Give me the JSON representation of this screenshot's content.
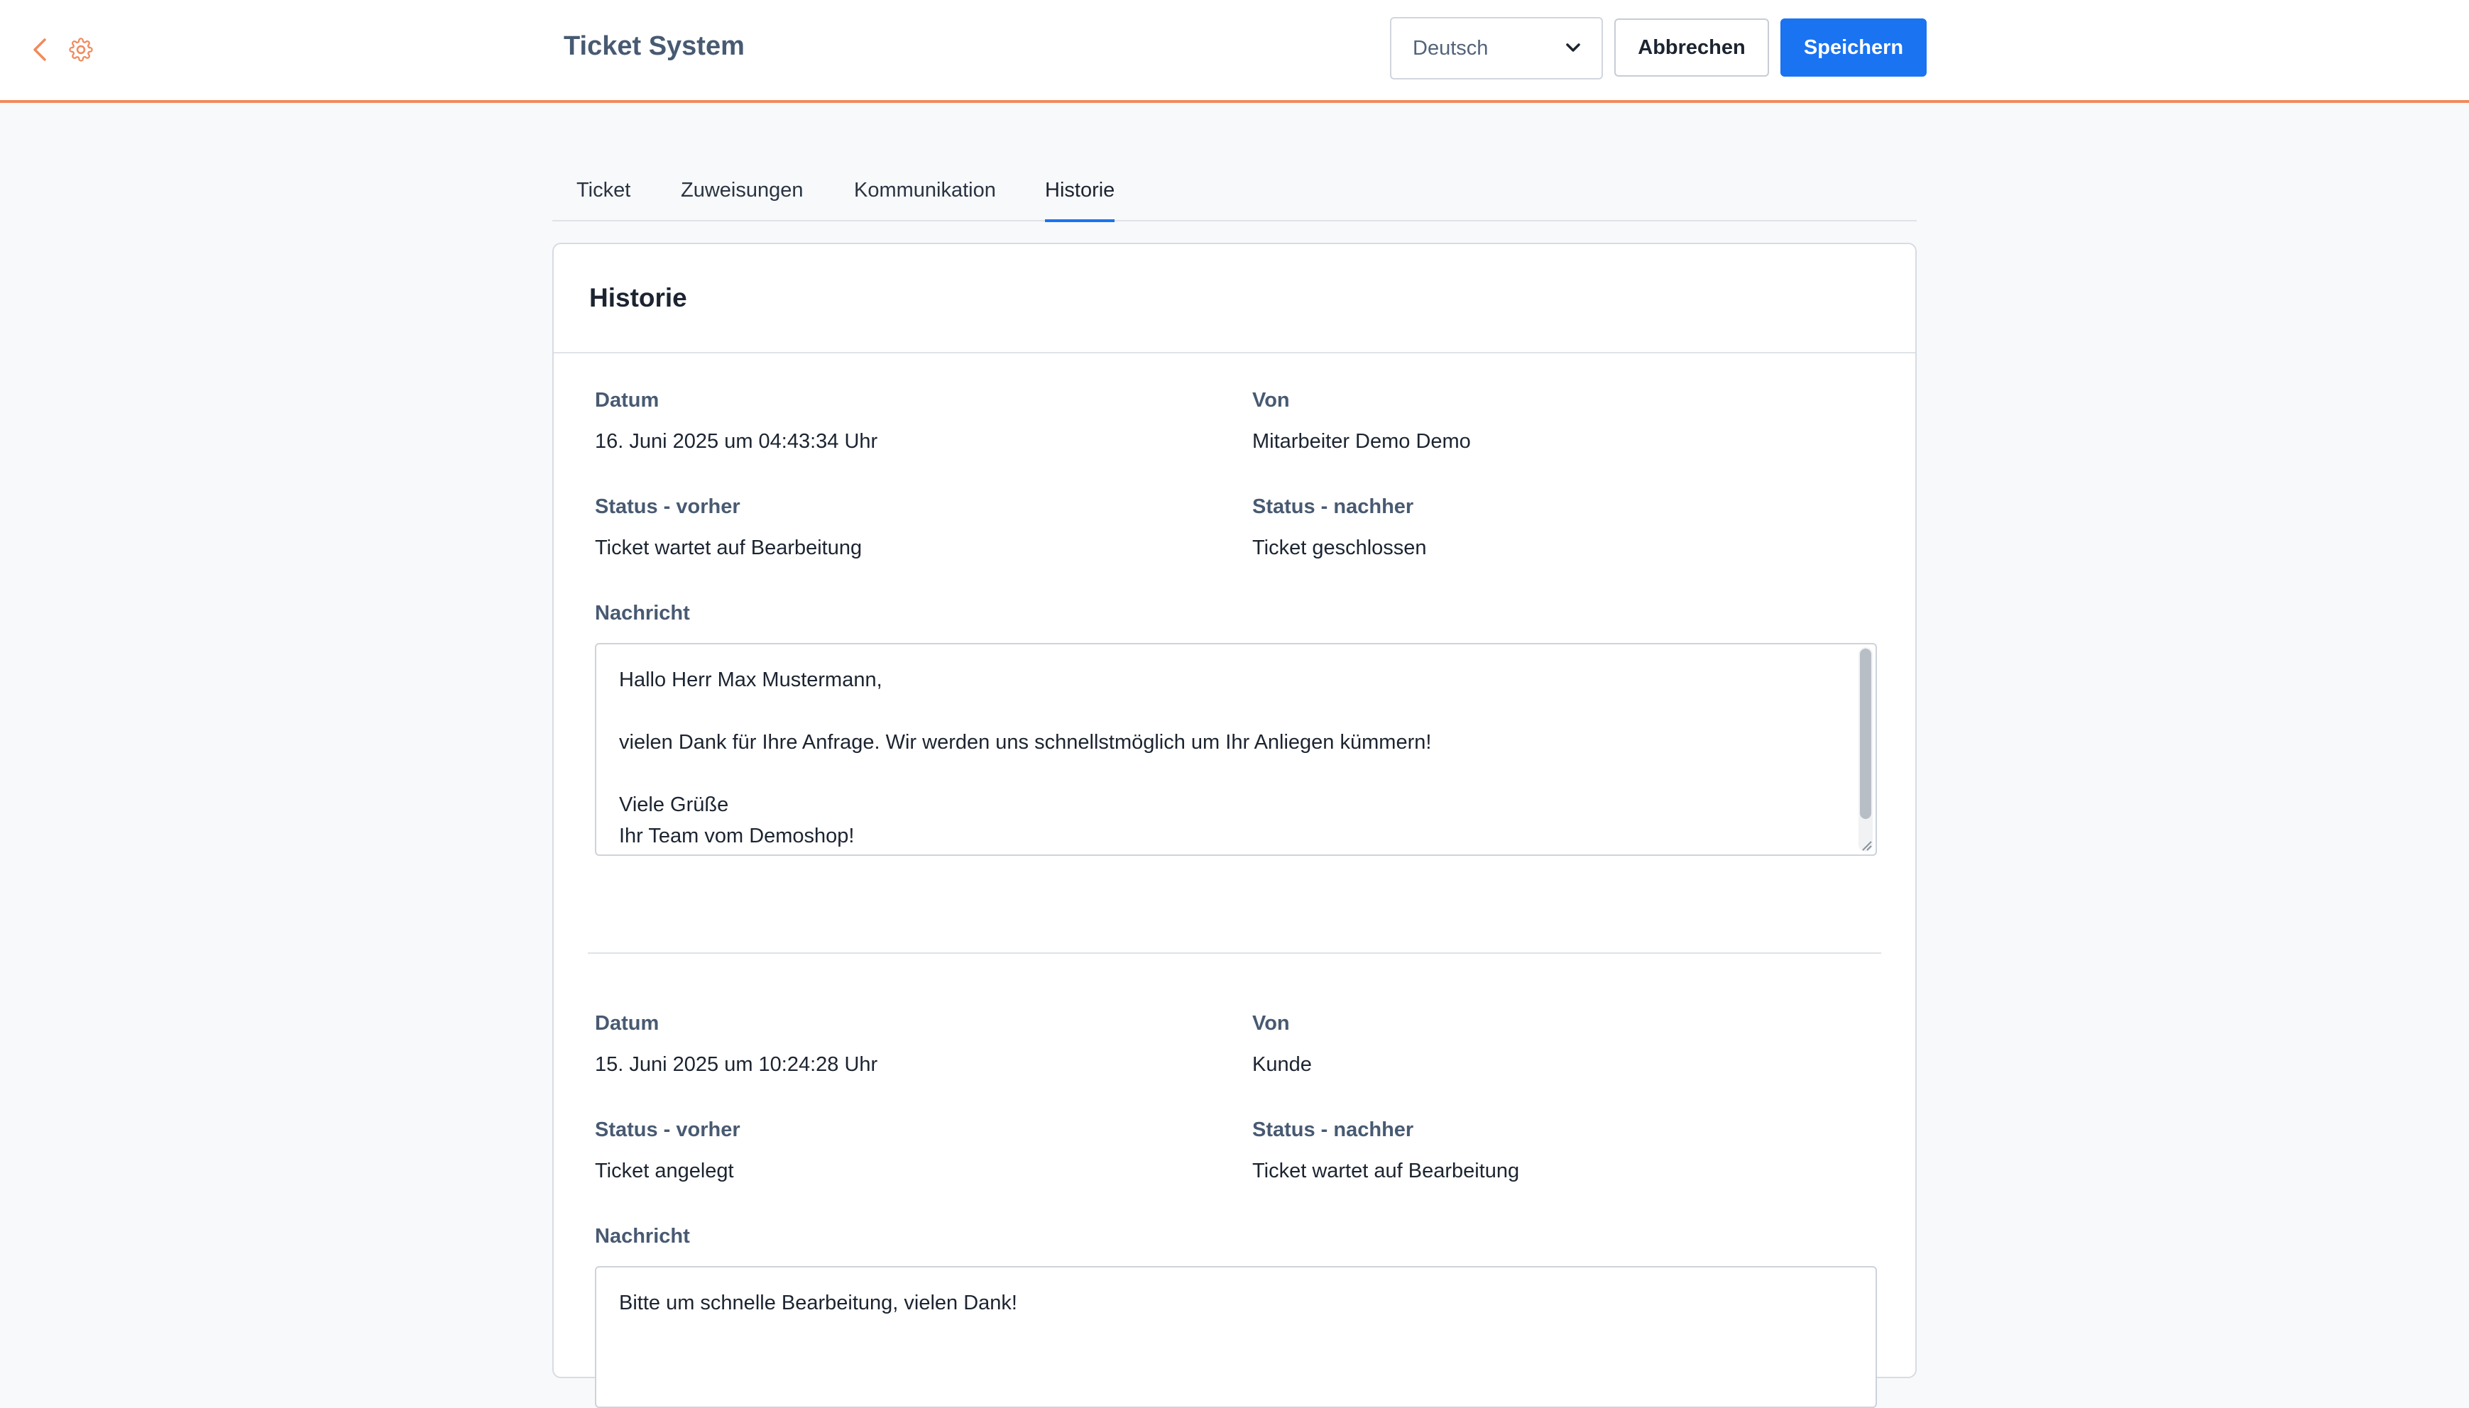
{
  "header": {
    "title": "Ticket System",
    "language_selected": "Deutsch",
    "cancel_label": "Abbrechen",
    "save_label": "Speichern",
    "accent_color": "#f08a5d",
    "primary_color": "#1a73f0",
    "icons": [
      "chevron-left-icon",
      "gear-icon",
      "chevron-down-icon"
    ]
  },
  "tabs": [
    {
      "label": "Ticket",
      "active": false
    },
    {
      "label": "Zuweisungen",
      "active": false
    },
    {
      "label": "Kommunikation",
      "active": false
    },
    {
      "label": "Historie",
      "active": true
    }
  ],
  "card": {
    "title": "Historie"
  },
  "labels": {
    "date": "Datum",
    "from": "Von",
    "status_before": "Status - vorher",
    "status_after": "Status - nachher",
    "message": "Nachricht"
  },
  "entries": [
    {
      "date": "16. Juni 2025 um 04:43:34 Uhr",
      "from": "Mitarbeiter Demo Demo",
      "status_before": "Ticket wartet auf Bearbeitung",
      "status_after": "Ticket geschlossen",
      "message_lines": [
        "Hallo Herr Max Mustermann,",
        "",
        "vielen Dank für Ihre Anfrage. Wir werden uns schnellstmöglich um Ihr Anliegen kümmern!",
        "",
        "Viele Grüße",
        "Ihr Team vom Demoshop!"
      ]
    },
    {
      "date": "15. Juni 2025 um 10:24:28 Uhr",
      "from": "Kunde",
      "status_before": "Ticket angelegt",
      "status_after": "Ticket wartet auf Bearbeitung",
      "message_lines": [
        "Bitte um schnelle Bearbeitung, vielen Dank!"
      ]
    }
  ]
}
